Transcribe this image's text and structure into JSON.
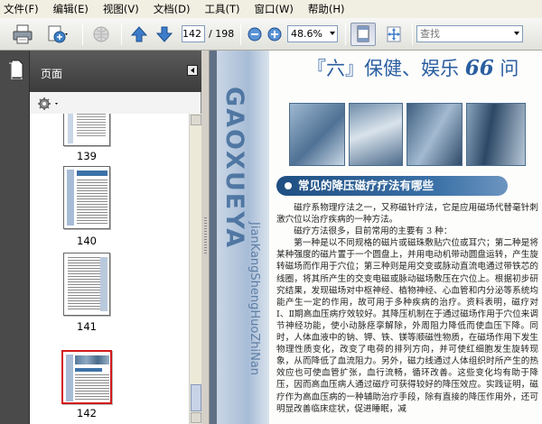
{
  "menu": [
    {
      "label": "文件(F)",
      "name": "menu-file"
    },
    {
      "label": "编辑(E)",
      "name": "menu-edit"
    },
    {
      "label": "视图(V)",
      "name": "menu-view"
    },
    {
      "label": "文档(D)",
      "name": "menu-document"
    },
    {
      "label": "工具(T)",
      "name": "menu-tools"
    },
    {
      "label": "窗口(W)",
      "name": "menu-window"
    },
    {
      "label": "帮助(H)",
      "name": "menu-help"
    }
  ],
  "toolbar": {
    "current_page": "142",
    "total_pages": "/ 198",
    "zoom": "48.6%",
    "search_placeholder": "查找"
  },
  "panel": {
    "title": "页面",
    "thumbnails": [
      {
        "label": "139"
      },
      {
        "label": "140"
      },
      {
        "label": "141"
      },
      {
        "label": "142",
        "selected": true
      }
    ]
  },
  "document": {
    "title_prefix": "『六』保健、娱乐 ",
    "title_number": "66",
    "title_suffix": " 问",
    "side_text_large": "GAOXUEYA",
    "side_text_small": "JianKangShengHuoZhiNan",
    "section_heading": "常见的降压磁疗疗法有哪些",
    "paragraphs": [
      "磁疗系物理疗法之一，又称磁针疗法，它是应用磁场代替毫针刺激穴位以治疗疾病的一种方法。",
      "磁疗方法很多，目前常用的主要有 3 种：",
      "第一种是以不同规格的磁片或磁珠敷贴穴位或耳穴；第二种是将某种强度的磁片置于一个圆盘上，并用电动机带动圆盘运转，产生旋转磁场而作用于穴位；第三种则是用交变或脉动直流电通过带铁芯的线圈，将其所产生的交变电磁或脉动磁场敷压在穴位上。根据初步研究结果，发现磁场对中枢神经、植物神经、心血管和内分泌等系统均能产生一定的作用，故可用于多种疾病的治疗。资料表明，磁疗对Ⅰ、Ⅱ期高血压病疗效较好。其降压机制在于通过磁场作用于穴位来调节神经功能，使小动脉痉挛解除，外周阻力降低而使血压下降。同时，人体血液中的钠、钾、铁、镁等顺磁性物质，在磁场作用下发生物理性质变化，改变了电荷的排列方向，并可使红细胞发生旋转现象，从而降低了血流阻力。另外，磁力线通过人体组织时所产生的热效应也可使血管扩张，血行流畅，循环改善。这些变化均有助于降压，因而高血压病人通过磁疗可获得较好的降压效应。实践证明，磁疗作为高血压病的一种辅助治疗手段，除有直接的降压作用外，还可明显改善临床症状，促进睡眠，减"
    ]
  }
}
